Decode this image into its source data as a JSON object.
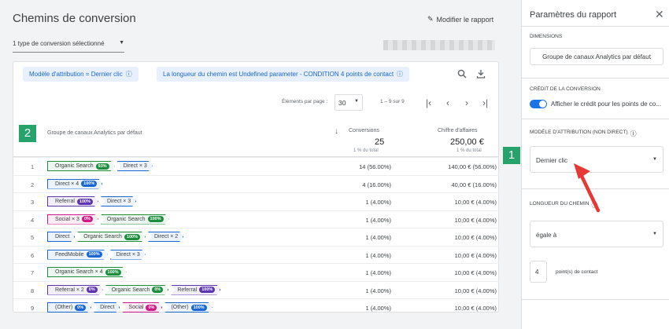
{
  "main": {
    "title": "Chemins de conversion",
    "edit_label": "Modifier le rapport",
    "conversion_select": "1 type de conversion sélectionné"
  },
  "chips": [
    "Modèle d'attribution = Dernier clic",
    "La longueur du chemin est Undefined parameter - CONDITION 4 points de contact"
  ],
  "pager": {
    "label": "Éléments par page :",
    "size": "30",
    "range": "1 – 9 sur 9"
  },
  "badges": {
    "table": "2",
    "panel": "1"
  },
  "table": {
    "dimension_header": "Groupe de canaux Analytics par défaut",
    "col_conv": "Conversions",
    "col_rev": "Chiffre d'affaires",
    "total_conv": "25",
    "total_rev": "250,00 €",
    "total_conv_sub": "1 % du total",
    "total_rev_sub": "1 % du total",
    "rows": [
      {
        "n": "1",
        "path": [
          {
            "label": "Organic Search",
            "badge": "93%",
            "type": "green"
          },
          {
            "label": "Direct × 3",
            "type": "blue"
          }
        ],
        "conv": "14 (56.00%)",
        "rev": "140,00 € (56.00%)"
      },
      {
        "n": "2",
        "path": [
          {
            "label": "Direct × 4",
            "badge": "100%",
            "type": "blue"
          }
        ],
        "conv": "4 (16.00%)",
        "rev": "40,00 € (16.00%)"
      },
      {
        "n": "3",
        "path": [
          {
            "label": "Referral",
            "badge": "100%",
            "type": "purple"
          },
          {
            "label": "Direct × 3",
            "type": "blue"
          }
        ],
        "conv": "1 (4.00%)",
        "rev": "10,00 € (4.00%)"
      },
      {
        "n": "4",
        "path": [
          {
            "label": "Social × 3",
            "badge": "0%",
            "type": "pink"
          },
          {
            "label": "Organic Search",
            "badge": "100%",
            "type": "green"
          }
        ],
        "conv": "1 (4.00%)",
        "rev": "10,00 € (4.00%)"
      },
      {
        "n": "5",
        "path": [
          {
            "label": "Direct",
            "type": "blue"
          },
          {
            "label": "Organic Search",
            "badge": "100%",
            "type": "green"
          },
          {
            "label": "Direct × 2",
            "type": "blue"
          }
        ],
        "conv": "1 (4.00%)",
        "rev": "10,00 € (4.00%)"
      },
      {
        "n": "6",
        "path": [
          {
            "label": "FeedMobile",
            "badge": "100%",
            "type": "blue"
          },
          {
            "label": "Direct × 3",
            "type": "blue"
          }
        ],
        "conv": "1 (4.00%)",
        "rev": "10,00 € (4.00%)"
      },
      {
        "n": "7",
        "path": [
          {
            "label": "Organic Search × 4",
            "badge": "100%",
            "type": "green"
          }
        ],
        "conv": "1 (4.00%)",
        "rev": "10,00 € (4.00%)"
      },
      {
        "n": "8",
        "path": [
          {
            "label": "Referral × 2",
            "badge": "0%",
            "type": "purple"
          },
          {
            "label": "Organic Search",
            "badge": "0%",
            "type": "green"
          },
          {
            "label": "Referral",
            "badge": "100%",
            "type": "purple"
          }
        ],
        "conv": "1 (4.00%)",
        "rev": "10,00 € (4.00%)"
      },
      {
        "n": "9",
        "path": [
          {
            "label": "(Other)",
            "badge": "0%",
            "type": "blue"
          },
          {
            "label": "Direct",
            "type": "blue"
          },
          {
            "label": "Social",
            "badge": "0%",
            "type": "pink"
          },
          {
            "label": "(Other)",
            "badge": "100%",
            "type": "blue"
          }
        ],
        "conv": "1 (4.00%)",
        "rev": "10,00 € (4.00%)"
      }
    ]
  },
  "panel": {
    "title": "Paramètres du rapport",
    "dimensions_label": "DIMENSIONS",
    "dimension_value": "Groupe de canaux Analytics par défaut",
    "credit_label": "CRÉDIT DE LA CONVERSION",
    "credit_toggle_text": "Afficher le crédit pour les points de co...",
    "model_label": "MODÈLE D'ATTRIBUTION (NON DIRECT)",
    "model_value": "Dernier clic",
    "length_label": "LONGUEUR DU CHEMIN",
    "length_op": "égale à",
    "length_value": "4",
    "length_unit": "point(s) de contact"
  },
  "colors": {
    "green": "#1e8e3e",
    "blue": "#1967d2",
    "purple": "#5e35b1",
    "pink": "#d01884",
    "badge": "#26a36b",
    "arrow": "#e53935"
  }
}
